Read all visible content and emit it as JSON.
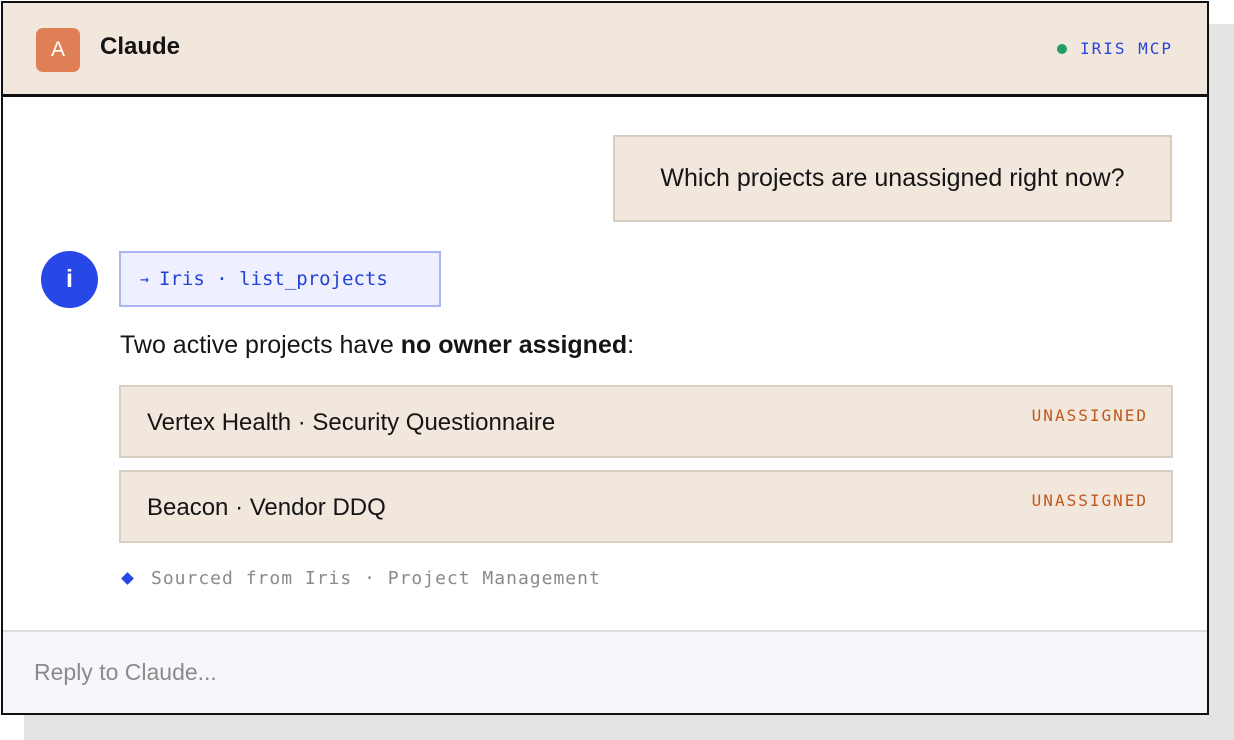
{
  "header": {
    "avatar_letter": "A",
    "title": "Claude",
    "status_label": "IRIS MCP",
    "status_color": "#1f9e6a"
  },
  "conversation": {
    "user_message": "Which projects are unassigned right now?",
    "assistant_icon_letter": "i",
    "tool_call": {
      "arrow": "→",
      "label": "Iris · list_projects"
    },
    "reply": {
      "prefix": "Two active projects have ",
      "bold": "no owner assigned",
      "suffix": ":"
    },
    "projects": [
      {
        "name": "Vertex Health · Security Questionnaire",
        "status": "UNASSIGNED"
      },
      {
        "name": "Beacon · Vendor DDQ",
        "status": "UNASSIGNED"
      }
    ],
    "source": "Sourced from Iris · Project Management"
  },
  "composer": {
    "placeholder": "Reply to Claude..."
  },
  "colors": {
    "accent_blue": "#2747e6",
    "header_bg": "#f1e7dc",
    "badge_orange": "#c1581b",
    "avatar_orange": "#de7f55"
  }
}
